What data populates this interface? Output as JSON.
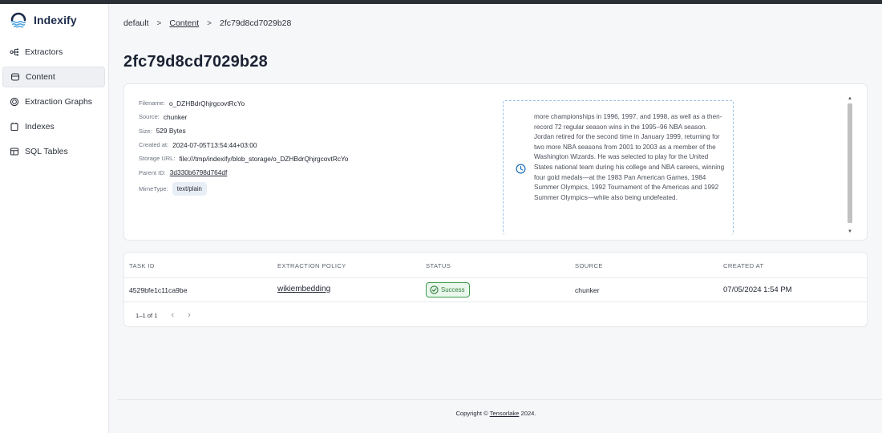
{
  "app": {
    "name": "Indexify"
  },
  "sidebar": {
    "items": [
      {
        "label": "Extractors",
        "icon": "extractors-icon",
        "active": false
      },
      {
        "label": "Content",
        "icon": "content-icon",
        "active": true
      },
      {
        "label": "Extraction Graphs",
        "icon": "extraction-graphs-icon",
        "active": false
      },
      {
        "label": "Indexes",
        "icon": "indexes-icon",
        "active": false
      },
      {
        "label": "SQL Tables",
        "icon": "sql-tables-icon",
        "active": false
      }
    ]
  },
  "breadcrumb": {
    "namespace": "default",
    "section": "Content",
    "current": "2fc79d8cd7029b28",
    "separator": ">"
  },
  "page": {
    "title": "2fc79d8cd7029b28"
  },
  "details": {
    "filename_label": "Filename:",
    "filename": "o_DZHBdrQhjrgcovtRcYo",
    "source_label": "Source:",
    "source": "chunker",
    "size_label": "Size:",
    "size": "529 Bytes",
    "created_label": "Created at:",
    "created": "2024-07-05T13:54:44+03:00",
    "storage_label": "Storage URL:",
    "storage": "file:///tmp/indexify/blob_storage/o_DZHBdrQhjrgcovtRcYo",
    "parent_label": "Parent ID:",
    "parent": "3d330b6798d764df",
    "mime_label": "MimeType:",
    "mime": "text/plain"
  },
  "preview": {
    "icon": "clock-icon",
    "text": "more championships in 1996, 1997, and 1998, as well as a then-record 72 regular season wins in the 1995–96 NBA season. Jordan retired for the second time in January 1999, returning for two more NBA seasons from 2001 to 2003 as a member of the Washington Wizards. He was selected to play for the United States national team during his college and NBA careers, winning four gold medals—at the 1983 Pan American Games, 1984 Summer Olympics, 1992 Tournament of the Americas and 1992 Summer Olympics—while also being undefeated."
  },
  "tasks": {
    "headers": [
      "TASK ID",
      "EXTRACTION POLICY",
      "STATUS",
      "SOURCE",
      "CREATED AT"
    ],
    "rows": [
      {
        "task_id": "4529bfe1c11ca9be",
        "policy": "wikiembedding",
        "status": "Success",
        "source": "chunker",
        "created": "07/05/2024 1:54 PM"
      }
    ],
    "pagination": "1–1 of 1"
  },
  "footer": {
    "prefix": "Copyright ©",
    "company": "Tensorlake",
    "suffix": "2024."
  },
  "colors": {
    "accent": "#1d6fb8",
    "success": "#2f7d3c",
    "brand_text": "#1b2a4a"
  }
}
